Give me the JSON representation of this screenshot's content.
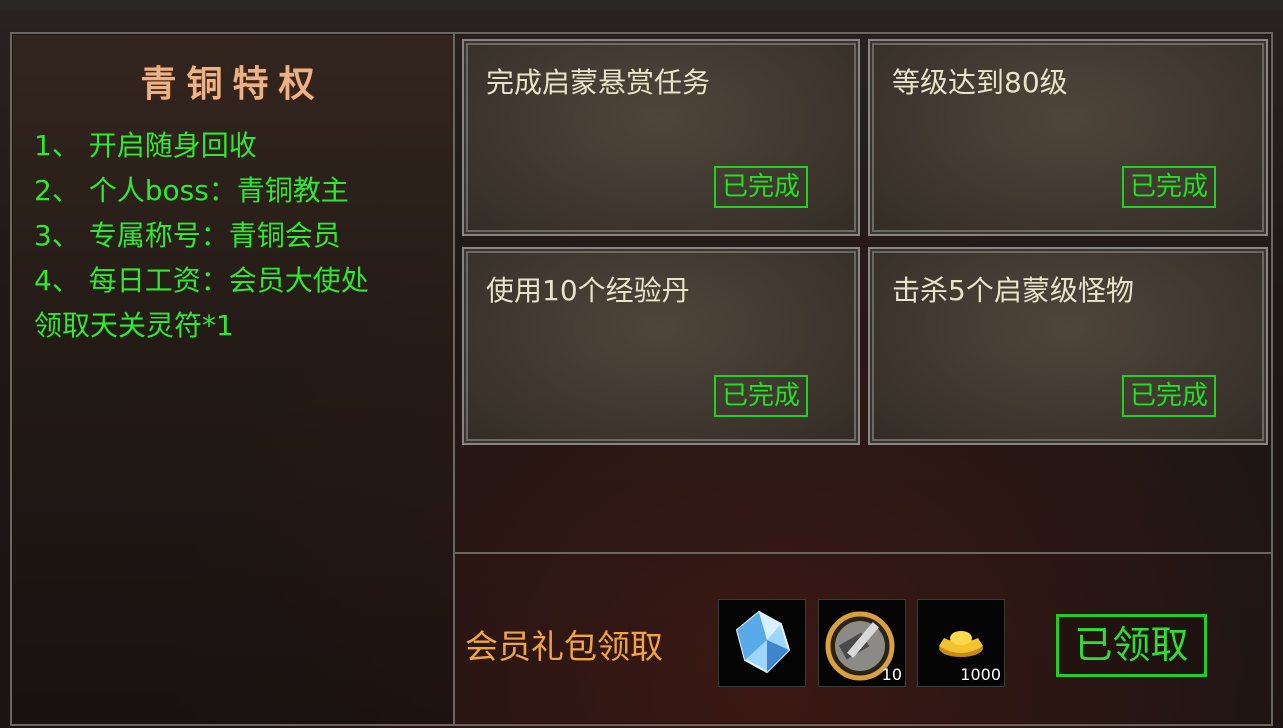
{
  "left_panel": {
    "title": "青铜特权",
    "perks": [
      "1、 开启随身回收",
      "2、 个人boss：青铜教主",
      "3、 专属称号：青铜会员",
      "4、 每日工资：会员大使处",
      "领取天关灵符*1"
    ]
  },
  "tasks": [
    {
      "title": "完成启蒙悬赏任务",
      "status": "已完成"
    },
    {
      "title": "等级达到80级",
      "status": "已完成"
    },
    {
      "title": "使用10个经验丹",
      "status": "已完成"
    },
    {
      "title": "击杀5个启蒙级怪物",
      "status": "已完成"
    }
  ],
  "gift": {
    "label": "会员礼包领取",
    "items": [
      {
        "icon": "blue-crystal-icon",
        "count": ""
      },
      {
        "icon": "hammer-medal-icon",
        "count": "10"
      },
      {
        "icon": "gold-ingot-icon",
        "count": "1000"
      }
    ],
    "claim_label": "已领取"
  },
  "colors": {
    "perk_text": "#2fe82f",
    "title_text": "#e8b38a",
    "status_green": "#22e022",
    "gift_label": "#f0a542"
  }
}
